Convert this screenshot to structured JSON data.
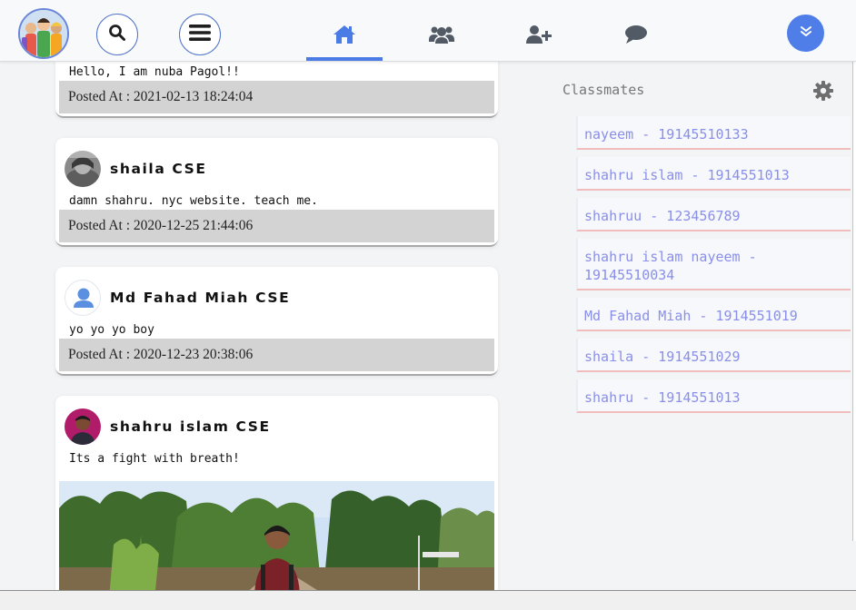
{
  "nav": {
    "logo_icon": "group-avatar-logo",
    "search_icon": "search-icon",
    "menu_icon": "hamburger-icon",
    "items": [
      {
        "icon": "home-icon",
        "active": true
      },
      {
        "icon": "users-icon",
        "active": false
      },
      {
        "icon": "user-plus-icon",
        "active": false
      },
      {
        "icon": "chat-bubble-icon",
        "active": false
      }
    ],
    "dropdown_icon": "double-chevron-down-icon",
    "accent_color": "#4b7be5"
  },
  "posts": [
    {
      "author": "",
      "text": "Hello, I am nuba Pagol!!",
      "posted_at": "Posted At : 2021-02-13 18:24:04"
    },
    {
      "author": "shaila CSE",
      "text": "damn shahru. nyc website. teach me.",
      "posted_at": "Posted At : 2020-12-25 21:44:06"
    },
    {
      "author": "Md Fahad Miah CSE",
      "text": "yo yo yo boy",
      "posted_at": "Posted At : 2020-12-23 20:38:06"
    },
    {
      "author": "shahru islam CSE",
      "text": "Its a fight with breath!",
      "has_image": true
    }
  ],
  "sidebar": {
    "title": "Classmates",
    "settings_icon": "gear-icon",
    "classmates": [
      "nayeem - 19145510133",
      "shahru islam - 1914551013",
      "shahruu - 123456789",
      "shahru islam nayeem - 19145510034",
      "Md Fahad Miah - 1914551019",
      "shaila - 1914551029",
      "shahru - 1914551013"
    ]
  }
}
